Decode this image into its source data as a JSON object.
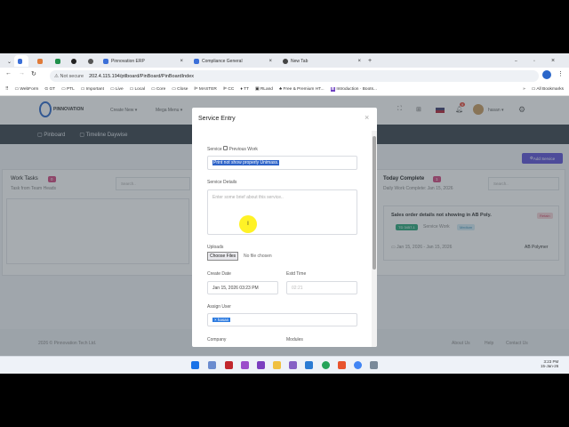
{
  "browser": {
    "tabs": [
      {
        "label": "Pinnovation ERP"
      },
      {
        "label": "Compliance General"
      },
      {
        "label": "New Tab"
      }
    ],
    "security": "Not secure",
    "url": "202.4.115.194/ptlboard/PinBoard/PinBoardIndex",
    "bookmarks": [
      "WebForm",
      "GT",
      "PTL",
      "Important",
      "Live",
      "Local",
      "Core",
      "Close",
      "MASTER",
      "CC",
      "TT",
      "RLand",
      "Free & Premium HT...",
      "Introduction · Boots..."
    ],
    "all_bookmarks": "All Bookmarks"
  },
  "header": {
    "logo": "PINNOVATION",
    "menus": [
      "Create New ▾",
      "Mega Menu ▾"
    ],
    "notif_count": "9",
    "user": "hasan ▾"
  },
  "subnav": [
    "Pinboard",
    "Timeline Daywise"
  ],
  "add_service": "Add Service",
  "work_tasks": {
    "title": "Work Tasks",
    "count": "0",
    "subtitle": "Task from Team Heads",
    "search": "Search.."
  },
  "today": {
    "title": "Today Complete",
    "count": "1",
    "subtitle": "Daily Work Complete: Jan 15, 2026",
    "search": "Search..",
    "task": {
      "title": "Sales order details not showing in AB Poly.",
      "tag": "Retain",
      "id": "TD 3457-1",
      "type": "Service Work",
      "priority": "Medium",
      "dates": "Jan 15, 2026 - Jan 15, 2026",
      "company": "AB Polymer"
    }
  },
  "footer": {
    "copyright": "2026 © Pinnovation Tech Ltd.",
    "links": [
      "About Us",
      "Help",
      "Contact Us"
    ]
  },
  "modal": {
    "title": "Service Entry",
    "close": "×",
    "service_label": "Service",
    "previous_work": "Previous Work",
    "service_value": "Print not show properly Unimass.",
    "details_label": "Service Details",
    "details_placeholder": "Enter some brief about this service..",
    "uploads_label": "Uploads",
    "choose_files": "Choose Files",
    "no_file": "No file chosen",
    "create_date_label": "Create Date",
    "create_date": "Jan 15, 2026 03:23 PM",
    "estd_label": "Estd Time",
    "estd_placeholder": "02:21",
    "assign_label": "Assign User",
    "assigned": "× hasan",
    "company_label": "Company",
    "modules_label": "Modules"
  },
  "taskbar": {
    "time": "3:23 PM",
    "date": "15-Jan-26"
  }
}
